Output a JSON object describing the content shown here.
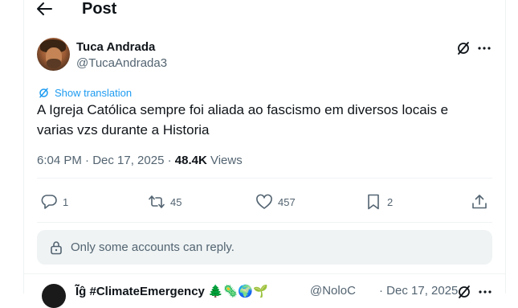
{
  "header": {
    "title": "Post"
  },
  "tweet": {
    "author_name": "Tuca Andrada",
    "author_handle": "@TucaAndrada3",
    "translate_label": "Show translation",
    "text": "A Igreja Católica sempre foi aliada ao fascismo em diversos locais e varias vzs durante a Historia",
    "time": "6:04 PM · Dec 17, 2025 · ",
    "views_count": "48.4K",
    "views_label": " Views"
  },
  "actions": {
    "replies": "1",
    "reposts": "45",
    "likes": "457",
    "bookmarks": "2"
  },
  "reply_restriction": "Only some accounts can reply.",
  "next_post": {
    "author_name": "Ĩ̃ĝ #ClimateEmergency 🌲🦠🌍🌱",
    "author_handle": "@NoloC",
    "date": "· Dec 17, 2025"
  },
  "colors": {
    "accent": "#1d9bf0",
    "secondary_text": "#536471",
    "primary_text": "#0f1419",
    "border": "#eff3f4"
  },
  "icons": [
    "back-arrow-icon",
    "grok-icon",
    "more-icon",
    "translate-icon",
    "reply-icon",
    "repost-icon",
    "like-icon",
    "bookmark-icon",
    "share-icon",
    "lock-icon"
  ]
}
